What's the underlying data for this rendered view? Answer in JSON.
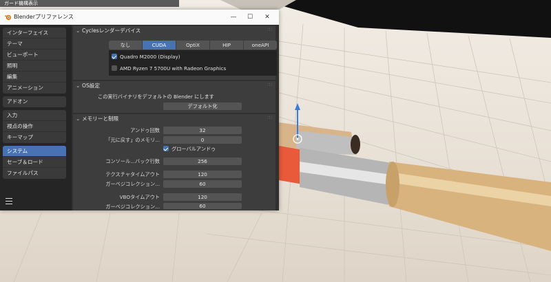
{
  "viewport": {
    "header_label": "ガード機構表示"
  },
  "window": {
    "title": "Blenderプリファレンス"
  },
  "sidebar": {
    "groups": [
      [
        "インターフェイス",
        "テーマ",
        "ビューポート",
        "照明",
        "編集",
        "アニメーション"
      ],
      [
        "アドオン"
      ],
      [
        "入力",
        "視点の操作",
        "キーマップ"
      ],
      [
        "システム",
        "セーブ＆ロード",
        "ファイルパス"
      ]
    ],
    "active": "システム"
  },
  "cycles": {
    "header": "Cyclesレンダーデバイス",
    "tabs": [
      "なし",
      "CUDA",
      "OptiX",
      "HIP",
      "oneAPI"
    ],
    "active_tab": "CUDA",
    "devices": [
      {
        "label": "Quadro M2000 (Display)",
        "checked": true
      },
      {
        "label": "AMD Ryzen 7 5700U with Radeon Graphics",
        "checked": false
      }
    ]
  },
  "os": {
    "header": "OS設定",
    "description": "この実行バイナリをデフォルトの Blender にします",
    "default_button": "デフォルト化"
  },
  "memory": {
    "header": "メモリーと制限",
    "undo_steps_label": "アンドゥ回数",
    "undo_steps_value": "32",
    "undo_memory_label": "「元に戻す」のメモリ...",
    "undo_memory_value": "0",
    "global_undo_label": "グローバルアンドゥ",
    "global_undo_checked": true,
    "console_label": "コンソール...バック行数",
    "console_value": "256",
    "tex_timeout_label": "テクスチャタイムアウト",
    "tex_timeout_value": "120",
    "gc1_label": "ガーベジコレクション...",
    "gc1_value": "60",
    "vbo_timeout_label": "VBOタイムアウト",
    "vbo_timeout_value": "120",
    "gc2_label": "ガーベジコレクション...",
    "gc2_value": "60"
  },
  "colors": {
    "accent": "#4772b3",
    "panel": "#3d3d3d",
    "field": "#545454",
    "window": "#303030"
  },
  "icons": [
    "blender-logo-icon",
    "minimize-icon",
    "maximize-icon",
    "close-icon",
    "checkbox-icon",
    "hamburger-menu-icon",
    "chevron-down-icon"
  ]
}
